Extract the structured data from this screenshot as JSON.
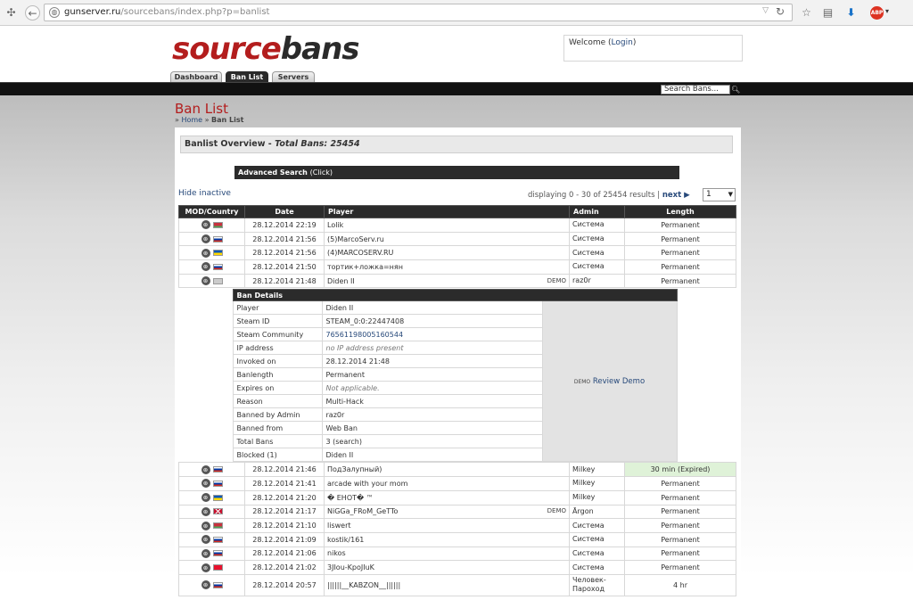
{
  "browser": {
    "url_host": "gunserver.ru",
    "url_path": "/sourcebans/index.php?p=banlist"
  },
  "header": {
    "logo_part1": "source",
    "logo_part2": "bans",
    "welcome_text": "Welcome (",
    "login_label": "Login",
    "welcome_close": ")"
  },
  "tabs": [
    {
      "label": "Dashboard"
    },
    {
      "label": "Ban List"
    },
    {
      "label": "Servers"
    }
  ],
  "search": {
    "placeholder": "Search Bans..."
  },
  "page": {
    "title": "Ban List",
    "breadcrumb_home": "Home",
    "breadcrumb_current": "Ban List",
    "overview_label": "Banlist Overview - ",
    "overview_total": "Total Bans: 25454",
    "advanced_search_label": "Advanced Search",
    "advanced_search_hint": "(Click)",
    "hide_inactive": "Hide inactive",
    "paging_text": "displaying 0 - 30 of 25454 results | ",
    "next_label": "next ▶",
    "page_select_value": "1"
  },
  "table": {
    "headers": [
      "MOD/Country",
      "Date",
      "Player",
      "Admin",
      "Length"
    ],
    "rows": [
      {
        "date": "28.12.2014 22:19",
        "player": "Lolik",
        "admin": "Система",
        "length": "Permanent",
        "flag": "by",
        "demo": false
      },
      {
        "date": "28.12.2014 21:56",
        "player": "(5)MarcoServ.ru",
        "admin": "Система",
        "length": "Permanent",
        "flag": "ru",
        "demo": false
      },
      {
        "date": "28.12.2014 21:56",
        "player": "(4)MARCOSERV.RU",
        "admin": "Система",
        "length": "Permanent",
        "flag": "ua",
        "demo": false
      },
      {
        "date": "28.12.2014 21:50",
        "player": "тортик+ложка=нян",
        "admin": "Система",
        "length": "Permanent",
        "flag": "ru",
        "demo": false
      },
      {
        "date": "28.12.2014 21:48",
        "player": "Diden II",
        "admin": "raz0r",
        "length": "Permanent",
        "flag": "unknown",
        "demo": true
      }
    ],
    "rows_after": [
      {
        "date": "28.12.2014 21:46",
        "player": "ПодЗалупный)",
        "admin": "Milkey",
        "length": "30 min (Expired)",
        "flag": "ru",
        "demo": false,
        "expired": true
      },
      {
        "date": "28.12.2014 21:41",
        "player": "arcade with your mom",
        "admin": "Milkey",
        "length": "Permanent",
        "flag": "ru",
        "demo": false
      },
      {
        "date": "28.12.2014 21:20",
        "player": "� EHOT� ™",
        "admin": "Milkey",
        "length": "Permanent",
        "flag": "ua",
        "demo": false
      },
      {
        "date": "28.12.2014 21:17",
        "player": "NiGGa_FRoM_GeTTo",
        "admin": "Ārgon",
        "length": "Permanent",
        "flag": "gb",
        "demo": true
      },
      {
        "date": "28.12.2014 21:10",
        "player": "liswert",
        "admin": "Система",
        "length": "Permanent",
        "flag": "by",
        "demo": false
      },
      {
        "date": "28.12.2014 21:09",
        "player": "kostik/161",
        "admin": "Система",
        "length": "Permanent",
        "flag": "ru",
        "demo": false
      },
      {
        "date": "28.12.2014 21:06",
        "player": "nikos",
        "admin": "Система",
        "length": "Permanent",
        "flag": "ru",
        "demo": false
      },
      {
        "date": "28.12.2014 21:02",
        "player": "3JIou-KpoJIuK",
        "admin": "Система",
        "length": "Permanent",
        "flag": "kg",
        "demo": false
      },
      {
        "date": "28.12.2014 20:57",
        "player": "||||||__KABZON__||||||",
        "admin": "Человек-Пароход",
        "length": "4 hr",
        "flag": "ru",
        "demo": false
      }
    ],
    "demo_label": "DEMO"
  },
  "ban_details": {
    "title": "Ban Details",
    "review_demo": "Review Demo",
    "demo_icon_label": "DEMO",
    "rows": [
      {
        "key": "Player",
        "value": "Diden II"
      },
      {
        "key": "Steam ID",
        "value": "STEAM_0:0:22447408"
      },
      {
        "key": "Steam Community",
        "value": "76561198005160544"
      },
      {
        "key": "IP address",
        "value": "no IP address present"
      },
      {
        "key": "Invoked on",
        "value": "28.12.2014 21:48"
      },
      {
        "key": "Banlength",
        "value": "Permanent"
      },
      {
        "key": "Expires on",
        "value": "Not applicable."
      },
      {
        "key": "Reason",
        "value": "Multi-Hack"
      },
      {
        "key": "Banned by Admin",
        "value": "raz0r"
      },
      {
        "key": "Banned from",
        "value": "Web Ban"
      },
      {
        "key": "Total Bans",
        "value": "3 (search)"
      },
      {
        "key": "Blocked (1)",
        "value": "Diden II"
      }
    ]
  },
  "colors": {
    "brand_red": "#b31d1d",
    "link_blue": "#27497a",
    "header_dark": "#2b2b2b",
    "expired_green": "#dff2d8"
  }
}
